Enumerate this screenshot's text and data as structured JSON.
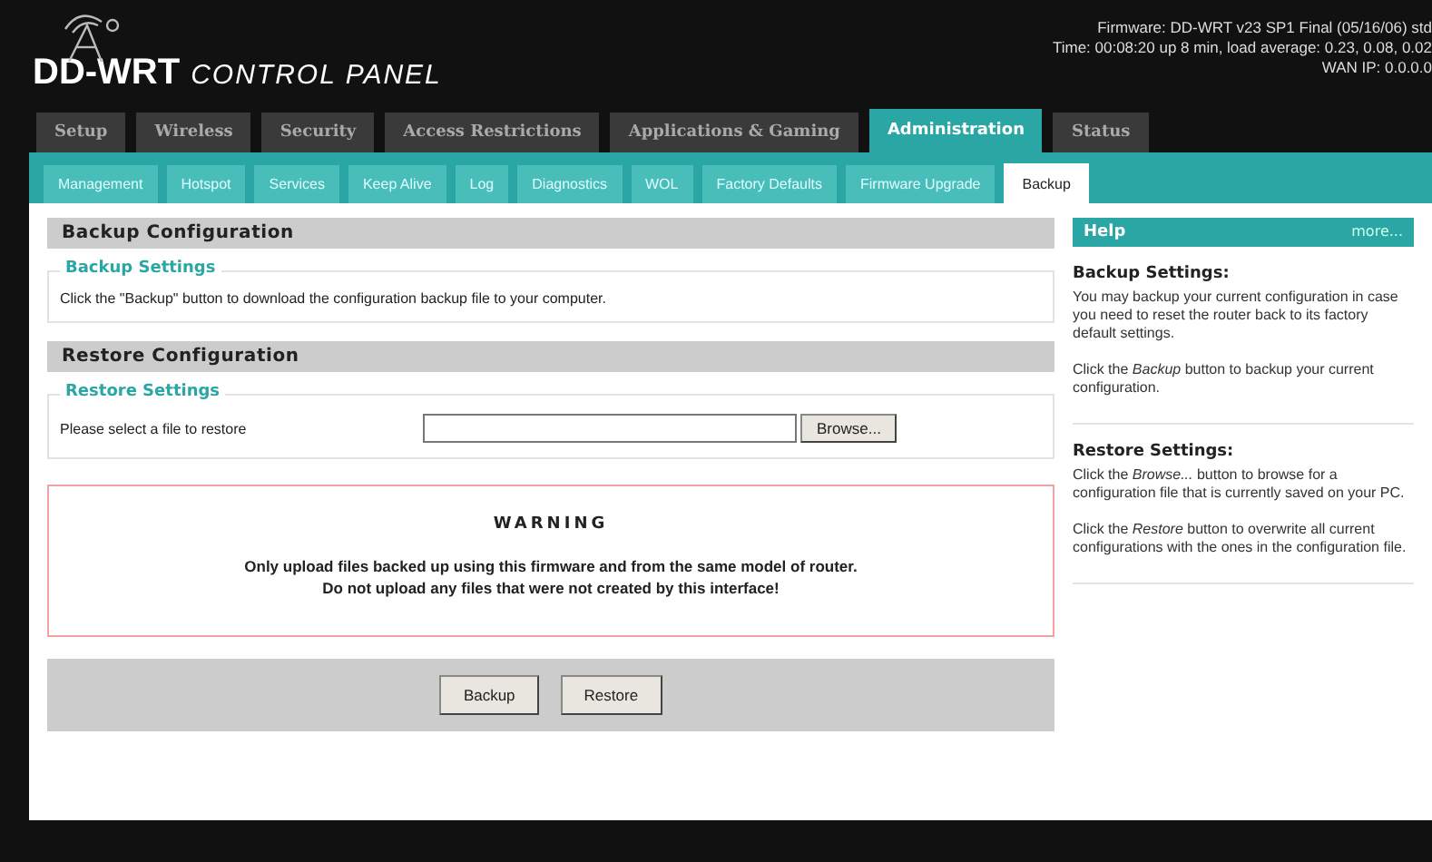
{
  "logo": {
    "brand": "DD-WRT",
    "subtitle": "CONTROL PANEL"
  },
  "info": [
    "Firmware: DD-WRT v23 SP1 Final (05/16/06) std",
    "Time: 00:08:20 up 8 min, load average: 0.23, 0.08, 0.02",
    "WAN IP: 0.0.0.0"
  ],
  "tabs": [
    {
      "label": "Setup",
      "selected": false
    },
    {
      "label": "Wireless",
      "selected": false
    },
    {
      "label": "Security",
      "selected": false
    },
    {
      "label": "Access Restrictions",
      "selected": false
    },
    {
      "label": "Applications & Gaming",
      "selected": false
    },
    {
      "label": "Administration",
      "selected": true
    },
    {
      "label": "Status",
      "selected": false
    }
  ],
  "subtabs": [
    {
      "label": "Management",
      "selected": false
    },
    {
      "label": "Hotspot",
      "selected": false
    },
    {
      "label": "Services",
      "selected": false
    },
    {
      "label": "Keep Alive",
      "selected": false
    },
    {
      "label": "Log",
      "selected": false
    },
    {
      "label": "Diagnostics",
      "selected": false
    },
    {
      "label": "WOL",
      "selected": false
    },
    {
      "label": "Factory Defaults",
      "selected": false
    },
    {
      "label": "Firmware Upgrade",
      "selected": false
    },
    {
      "label": "Backup",
      "selected": true
    }
  ],
  "backup": {
    "title": "Backup Configuration",
    "legend": "Backup Settings",
    "text": "Click the \"Backup\" button to download the configuration backup file to your computer."
  },
  "restore": {
    "title": "Restore Configuration",
    "legend": "Restore Settings",
    "label": "Please select a file to restore",
    "browse": "Browse..."
  },
  "warning": {
    "title": "WARNING",
    "lines": [
      "Only upload files backed up using this firmware and from the same model of router.",
      "Do not upload any files that were not created by this interface!"
    ]
  },
  "buttons": [
    "Backup",
    "Restore"
  ],
  "help": {
    "title": "Help",
    "more": "more...",
    "sections": [
      {
        "heading": "Backup Settings:",
        "paragraphs": [
          "You may backup your current configuration in case you need to reset the router back to its factory default settings.",
          "Click the *Backup* button to backup your current configuration."
        ]
      },
      {
        "heading": "Restore Settings:",
        "paragraphs": [
          "Click the *Browse...* button to browse for a configuration file that is currently saved on your PC.",
          "Click the *Restore* button to overwrite all current configurations with the ones in the configuration file."
        ]
      }
    ]
  }
}
